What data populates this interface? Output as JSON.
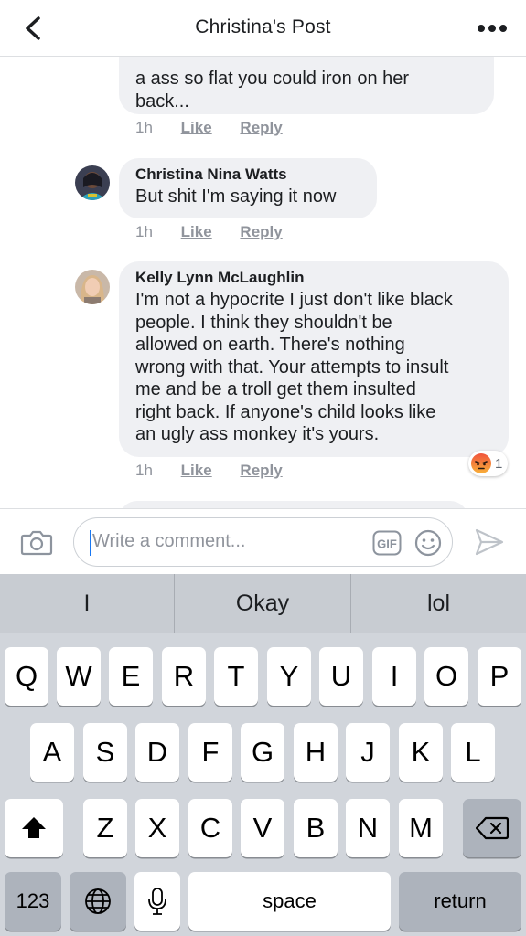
{
  "header": {
    "title": "Christina's Post"
  },
  "comments": [
    {
      "author": "",
      "text": "a ass so flat you could iron on her back...",
      "lines": [
        "a ass so flat you could iron on her",
        "back..."
      ],
      "time": "1h",
      "like_label": "Like",
      "reply_label": "Reply"
    },
    {
      "author": "Christina Nina Watts",
      "lines": [
        "But shit I'm saying it now"
      ],
      "time": "1h",
      "like_label": "Like",
      "reply_label": "Reply"
    },
    {
      "author": "Kelly Lynn McLaughlin",
      "lines": [
        "I'm not a hypocrite I just don't like black",
        "people. I think they shouldn't be",
        "allowed on earth. There's nothing",
        "wrong with that. Your attempts to insult",
        "me and be a troll get them insulted",
        "right back. If anyone's child looks like",
        "an ugly ass monkey it's yours."
      ],
      "time": "1h",
      "like_label": "Like",
      "reply_label": "Reply",
      "reaction": {
        "icon": "angry-face-icon",
        "count": "1"
      }
    }
  ],
  "composer": {
    "placeholder": "Write a comment...",
    "gif_label": "GIF"
  },
  "keyboard": {
    "suggestions": [
      "I",
      "Okay",
      "lol"
    ],
    "row1": [
      "Q",
      "W",
      "E",
      "R",
      "T",
      "Y",
      "U",
      "I",
      "O",
      "P"
    ],
    "row2": [
      "A",
      "S",
      "D",
      "F",
      "G",
      "H",
      "J",
      "K",
      "L"
    ],
    "row3": [
      "Z",
      "X",
      "C",
      "V",
      "B",
      "N",
      "M"
    ],
    "numbers_label": "123",
    "space_label": "space",
    "return_label": "return"
  },
  "colors": {
    "bubble": "#eff0f3",
    "meta_text": "#90949c",
    "keyboard_bg": "#d1d5db",
    "caret": "#1877f2"
  }
}
